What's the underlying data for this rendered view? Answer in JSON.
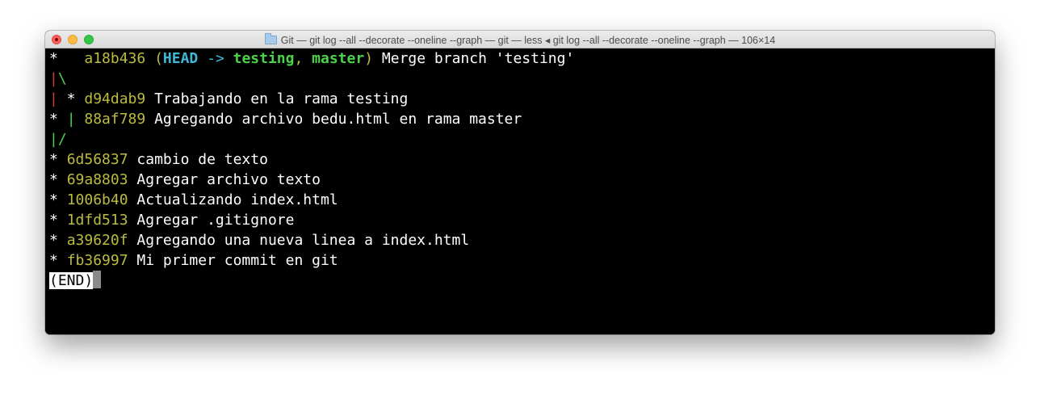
{
  "window": {
    "title": "Git — git log --all --decorate --oneline --graph — git — less ◂ git log --all --decorate --oneline --graph — 106×14"
  },
  "colors": {
    "terminal_bg": "#000000",
    "hash": "#bbbb3f",
    "head": "#3fb8d8",
    "branch": "#4ad24a",
    "graph_red": "#d23c3c",
    "graph_green": "#4ad24a"
  },
  "log": {
    "line1": {
      "graph": "*   ",
      "hash": "a18b436",
      "open_paren": "(",
      "head": "HEAD",
      "arrow": " -> ",
      "branch1": "testing",
      "comma": ", ",
      "branch2": "master",
      "close_paren": ")",
      "message": "Merge branch 'testing'"
    },
    "line2": {
      "bar": "|",
      "backslash": "\\"
    },
    "line3": {
      "bar": "|",
      "star": " * ",
      "hash": "d94dab9",
      "message": "Trabajando en la rama testing"
    },
    "line4": {
      "star": "* ",
      "bar": "|",
      "hash": "88af789",
      "message": "Agregando archivo bedu.html en rama master"
    },
    "line5": {
      "bar": "|",
      "slash": "/"
    },
    "commits": [
      {
        "star": "* ",
        "hash": "6d56837",
        "message": "cambio de texto"
      },
      {
        "star": "* ",
        "hash": "69a8803",
        "message": "Agregar archivo texto"
      },
      {
        "star": "* ",
        "hash": "1006b40",
        "message": "Actualizando index.html"
      },
      {
        "star": "* ",
        "hash": "1dfd513",
        "message": "Agregar .gitignore"
      },
      {
        "star": "* ",
        "hash": "a39620f",
        "message": "Agregando una nueva linea a index.html"
      },
      {
        "star": "* ",
        "hash": "fb36997",
        "message": "Mi primer commit en git"
      }
    ],
    "end_label": "(END)"
  }
}
